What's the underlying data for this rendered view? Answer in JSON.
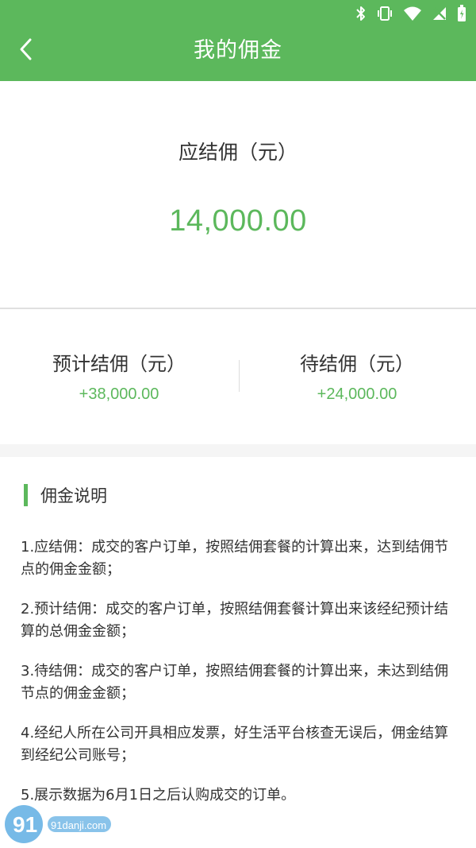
{
  "header": {
    "title": "我的佣金"
  },
  "hero": {
    "label": "应结佣（元）",
    "amount": "14,000.00"
  },
  "summary": {
    "left": {
      "label": "预计结佣（元）",
      "value": "+38,000.00"
    },
    "right": {
      "label": "待结佣（元）",
      "value": "+24,000.00"
    }
  },
  "explain": {
    "title": "佣金说明",
    "items": [
      "1.应结佣：成交的客户订单，按照结佣套餐的计算出来，达到结佣节点的佣金金额；",
      "2.预计结佣：成交的客户订单，按照结佣套餐计算出来该经纪预计结算的总佣金金额；",
      "3.待结佣：成交的客户订单，按照结佣套餐的计算出来，未达到结佣节点的佣金金额；",
      "4.经纪人所在公司开具相应发票，好生活平台核查无误后，佣金结算到经纪公司账号；",
      "5.展示数据为6月1日之后认购成交的订单。"
    ]
  },
  "watermark": {
    "domain": "91danji.com"
  },
  "colors": {
    "accent": "#5cb85c",
    "text": "#333333",
    "background": "#f5f5f5"
  },
  "icons": {
    "status": [
      "bluetooth-icon",
      "vibrate-icon",
      "wifi-icon",
      "no-signal-icon",
      "battery-icon"
    ],
    "back": "chevron-left-icon"
  }
}
